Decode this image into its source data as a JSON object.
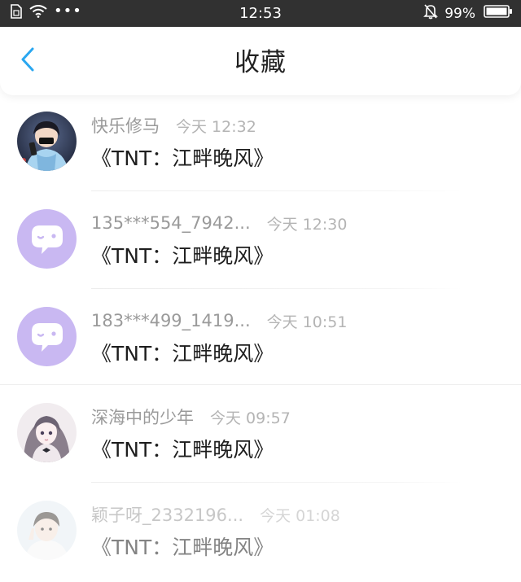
{
  "status_bar": {
    "time": "12:53",
    "battery": "99%",
    "dots": "•••"
  },
  "header": {
    "title": "收藏"
  },
  "favorites": [
    {
      "name": "快乐修马",
      "time": "今天 12:32",
      "title": "《TNT：江畔晚风》",
      "avatar": "photo-boy-headphones"
    },
    {
      "name": "135***554_7942...",
      "time": "今天 12:30",
      "title": "《TNT：江畔晚风》",
      "avatar": "default-chat-bubble"
    },
    {
      "name": "183***499_1419...",
      "time": "今天 10:51",
      "title": "《TNT：江畔晚风》",
      "avatar": "default-chat-bubble"
    },
    {
      "name": "深海中的少年",
      "time": "今天 09:57",
      "title": "《TNT：江畔晚风》",
      "avatar": "photo-anime-girl"
    },
    {
      "name": "颖子呀_2332196...",
      "time": "今天 01:08",
      "title": "《TNT：江畔晚风》",
      "avatar": "photo-child-peace-sign"
    }
  ],
  "colors": {
    "status_bar_bg": "#313131",
    "accent_back_arrow": "#2aa7f0",
    "default_avatar_bg": "#c9b8f2"
  }
}
